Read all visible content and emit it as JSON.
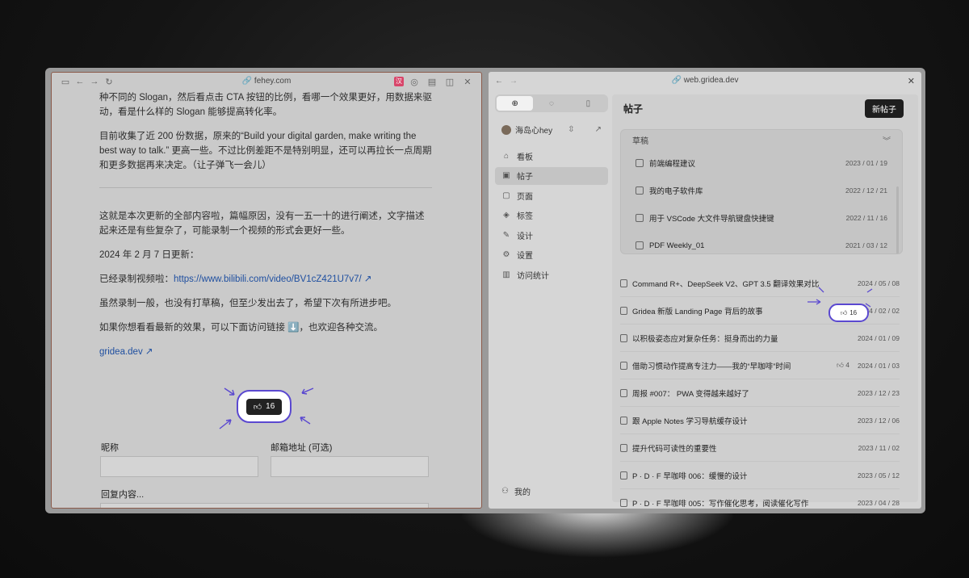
{
  "left": {
    "url": "fehey.com",
    "ext_badge": "汉",
    "paragraphs": [
      "种不同的 Slogan，然后看点击 CTA 按钮的比例，看哪一个效果更好，用数据来驱动，看是什么样的 Slogan 能够提高转化率。",
      "目前收集了近 200 份数据，原来的“Build your digital garden, make writing the best way to talk.” 更高一些。不过比例差距不是特别明显，还可以再拉长一点周期和更多数据再来决定。（让子弹飞一会儿）",
      "这就是本次更新的全部内容啦，篇幅原因，没有一五一十的进行阐述，文字描述起来还是有些复杂了，可能录制一个视频的形式会更好一些。",
      "2024 年 2 月 7 日更新：",
      "已经录制视频啦：",
      "虽然录制一般，也没有打草稿，但至少发出去了，希望下次有所进步吧。",
      "如果你想看看最新的效果，可以下面访问链接 ⬇️，也欢迎各种交流。"
    ],
    "video_link": "https://www.bilibili.com/video/BV1cZ421U7v7/",
    "site_link": "gridea.dev",
    "like_count": "16",
    "form": {
      "nickname_label": "昵称",
      "email_label": "邮箱地址 (可选)",
      "reply_label": "回复内容..."
    }
  },
  "right": {
    "url": "web.gridea.dev",
    "user_name": "海岛心hey",
    "nav": [
      {
        "label": "看板",
        "icon": "home-icon"
      },
      {
        "label": "帖子",
        "icon": "post-icon",
        "active": true
      },
      {
        "label": "页面",
        "icon": "page-icon"
      },
      {
        "label": "标签",
        "icon": "tag-icon"
      },
      {
        "label": "设计",
        "icon": "design-icon"
      },
      {
        "label": "设置",
        "icon": "settings-icon"
      },
      {
        "label": "访问统计",
        "icon": "stats-icon"
      }
    ],
    "bottom_label": "我的",
    "title": "帖子",
    "new_post": "新帖子",
    "drafts_title": "草稿",
    "drafts": [
      {
        "title": "前端编程建议",
        "date": "2023 / 01 / 19"
      },
      {
        "title": "我的电子软件库",
        "date": "2022 / 12 / 21"
      },
      {
        "title": "用于 VSCode 大文件导航键盘快捷键",
        "date": "2022 / 11 / 16"
      },
      {
        "title": "PDF Weekly_01",
        "date": "2021 / 03 / 12"
      }
    ],
    "posts": [
      {
        "title": "Command R+、DeepSeek V2、GPT 3.5 翻译效果对比",
        "date": "2024 / 05 / 08",
        "likes": ""
      },
      {
        "title": "Gridea 新版 Landing Page 背后的故事",
        "date": "2024 / 02 / 02",
        "likes": "16"
      },
      {
        "title": "以积极姿态应对复杂任务：挺身而出的力量",
        "date": "2024 / 01 / 09",
        "likes": ""
      },
      {
        "title": "借助习惯动作提高专注力——我的“早咖啡”时间",
        "date": "2024 / 01 / 03",
        "likes": "4"
      },
      {
        "title": "周报 #007： PWA 变得越来越好了",
        "date": "2023 / 12 / 23",
        "likes": ""
      },
      {
        "title": "跟 Apple Notes 学习导航缓存设计",
        "date": "2023 / 12 / 06",
        "likes": ""
      },
      {
        "title": "提升代码可读性的重要性",
        "date": "2023 / 11 / 02",
        "likes": ""
      },
      {
        "title": "P · D · F 早咖啡 006：缓慢的设计",
        "date": "2023 / 05 / 12",
        "likes": ""
      },
      {
        "title": "P · D · F 早咖啡 005：写作催化思考，阅读催化写作",
        "date": "2023 / 04 / 28",
        "likes": ""
      }
    ]
  }
}
